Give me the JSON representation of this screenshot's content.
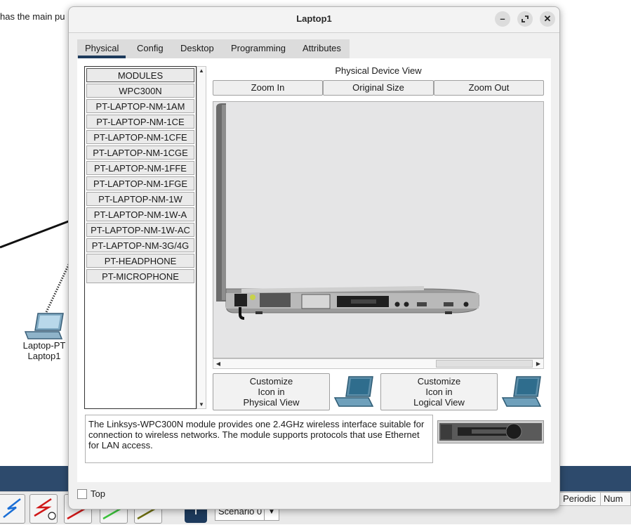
{
  "workspace": {
    "caption_fragment": "has the main pu",
    "device": {
      "type": "Laptop-PT",
      "name": "Laptop1"
    },
    "scenario": "Scenario 0",
    "pdu_columns": [
      "Periodic",
      "Num"
    ]
  },
  "dialog": {
    "title": "Laptop1",
    "window_controls": [
      "minimize-icon",
      "maximize-icon",
      "close-icon"
    ],
    "tabs": [
      {
        "label": "Physical",
        "active": true
      },
      {
        "label": "Config",
        "active": false
      },
      {
        "label": "Desktop",
        "active": false
      },
      {
        "label": "Programming",
        "active": false
      },
      {
        "label": "Attributes",
        "active": false
      }
    ],
    "modules": [
      "MODULES",
      "WPC300N",
      "PT-LAPTOP-NM-1AM",
      "PT-LAPTOP-NM-1CE",
      "PT-LAPTOP-NM-1CFE",
      "PT-LAPTOP-NM-1CGE",
      "PT-LAPTOP-NM-1FFE",
      "PT-LAPTOP-NM-1FGE",
      "PT-LAPTOP-NM-1W",
      "PT-LAPTOP-NM-1W-A",
      "PT-LAPTOP-NM-1W-AC",
      "PT-LAPTOP-NM-3G/4G",
      "PT-HEADPHONE",
      "PT-MICROPHONE"
    ],
    "physical_view": {
      "title": "Physical Device View",
      "zoom_in": "Zoom In",
      "original_size": "Original Size",
      "zoom_out": "Zoom Out"
    },
    "customize_physical": [
      "Customize",
      "Icon in",
      "Physical View"
    ],
    "customize_logical": [
      "Customize",
      "Icon in",
      "Logical View"
    ],
    "description": "The Linksys-WPC300N module provides one 2.4GHz wireless interface suitable for connection to wireless networks. The module supports protocols that use Ethernet for LAN access.",
    "top_checkbox": {
      "label": "Top",
      "checked": false
    }
  },
  "colors": {
    "accent": "#1d3a5c",
    "workspace_bar": "#2d4a6c",
    "dialog_bg": "#f0f0f0"
  }
}
